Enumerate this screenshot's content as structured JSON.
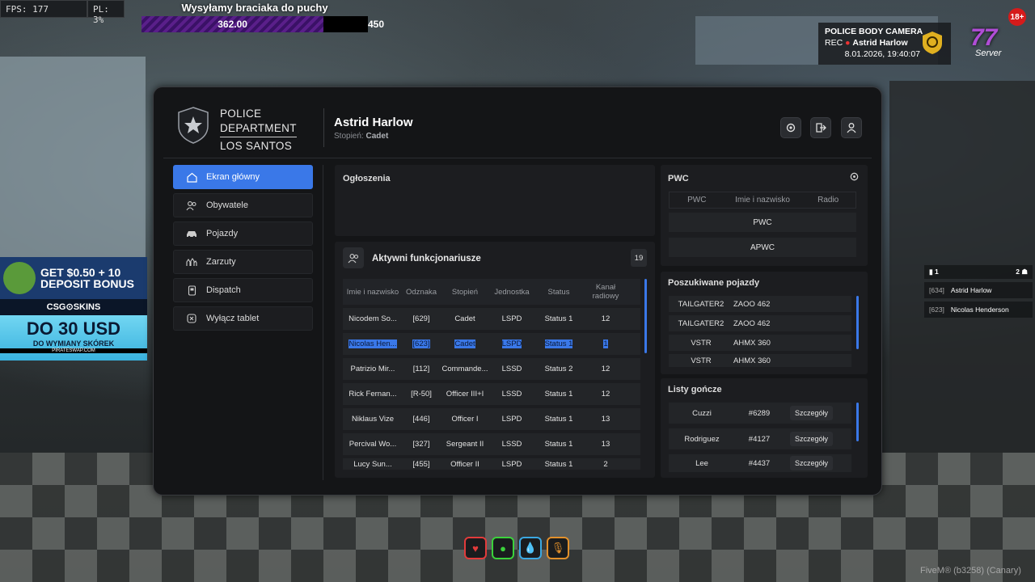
{
  "hud": {
    "fps": "FPS: 177",
    "pl": "PL: 3%",
    "promo_title": "Wysyłamy braciaka do puchy",
    "progress_value": "362.00",
    "progress_goal": "450",
    "progress_fraction": 0.8044
  },
  "bodycam": {
    "title": "POLICE BODY CAMERA",
    "rec": "REC",
    "name": "Astrid Harlow",
    "datetime": "8.01.2026, 19:40:07"
  },
  "server_logo": {
    "number": "77",
    "label": "Server",
    "age": "18+"
  },
  "ad": {
    "line1": "GET $0.50 + 10",
    "line2": "DEPOSIT BONUS",
    "brand": "CSG⊙SKINS",
    "big": "DO 30 USD",
    "small": "DO WYMIANY SKÓREK",
    "url": "PIRATESWAP.COM"
  },
  "side_list": {
    "header_left": "1",
    "header_right": "2",
    "rows": [
      {
        "id": "[634]",
        "name": "Astrid Harlow"
      },
      {
        "id": "[623]",
        "name": "Nicolas Henderson"
      }
    ]
  },
  "tablet": {
    "dept": {
      "line1": "POLICE",
      "line2": "DEPARTMENT",
      "line3": "LOS SANTOS"
    },
    "user": {
      "name": "Astrid Harlow",
      "rank_label": "Stopień:",
      "rank": "Cadet"
    },
    "nav": [
      {
        "label": "Ekran główny",
        "icon": "home-icon",
        "active": true
      },
      {
        "label": "Obywatele",
        "icon": "users-icon"
      },
      {
        "label": "Pojazdy",
        "icon": "car-icon"
      },
      {
        "label": "Zarzuty",
        "icon": "handcuffs-icon"
      },
      {
        "label": "Dispatch",
        "icon": "radio-icon"
      },
      {
        "label": "Wyłącz tablet",
        "icon": "close-box-icon"
      }
    ],
    "announcements": {
      "title": "Ogłoszenia"
    },
    "officers": {
      "title": "Aktywni funkcjonariusze",
      "count": "19",
      "columns": [
        "Imie i nazwisko",
        "Odznaka",
        "Stopień",
        "Jednostka",
        "Status",
        "Kanał radiowy"
      ],
      "rows": [
        [
          "Nicodem So...",
          "[629]",
          "Cadet",
          "LSPD",
          "Status 1",
          "12"
        ],
        [
          "Nicolas Hen...",
          "[623]",
          "Cadet",
          "LSPD",
          "Status 1",
          "1"
        ],
        [
          "Patrizio Mir...",
          "[112]",
          "Commande...",
          "LSSD",
          "Status 2",
          "12"
        ],
        [
          "Rick Fernan...",
          "[R-50]",
          "Officer III+I",
          "LSSD",
          "Status 1",
          "12"
        ],
        [
          "Niklaus Vize",
          "[446]",
          "Officer I",
          "LSPD",
          "Status 1",
          "13"
        ],
        [
          "Percival Wo...",
          "[327]",
          "Sergeant II",
          "LSSD",
          "Status 1",
          "13"
        ],
        [
          "Lucy Sun...",
          "[455]",
          "Officer II",
          "LSPD",
          "Status 1",
          "2"
        ]
      ]
    },
    "pwc": {
      "title": "PWC",
      "columns": [
        "PWC",
        "Imie i nazwisko",
        "Radio"
      ],
      "rows": [
        "PWC",
        "APWC"
      ]
    },
    "vehicles": {
      "title": "Poszukiwane pojazdy",
      "rows": [
        {
          "model": "TAILGATER2",
          "plate": "ZAOO 462"
        },
        {
          "model": "TAILGATER2",
          "plate": "ZAOO 462"
        },
        {
          "model": "VSTR",
          "plate": "AHMX 360"
        },
        {
          "model": "VSTR",
          "plate": "AHMX 360"
        }
      ]
    },
    "wanted": {
      "title": "Listy gończe",
      "button_label": "Szczegóły",
      "rows": [
        {
          "name": "Cuzzi",
          "id": "#6289"
        },
        {
          "name": "Rodriguez",
          "id": "#4127"
        },
        {
          "name": "Lee",
          "id": "#4437"
        }
      ]
    }
  },
  "status_icons": [
    {
      "icon": "heart-icon",
      "color": "#e23b3b"
    },
    {
      "icon": "food-icon",
      "color": "#3bd23b"
    },
    {
      "icon": "water-icon",
      "color": "#3ba8e2"
    },
    {
      "icon": "microphone-icon",
      "color": "#e2902b"
    }
  ],
  "footer": {
    "fivem": "FiveM® (b3258) (Canary)"
  }
}
